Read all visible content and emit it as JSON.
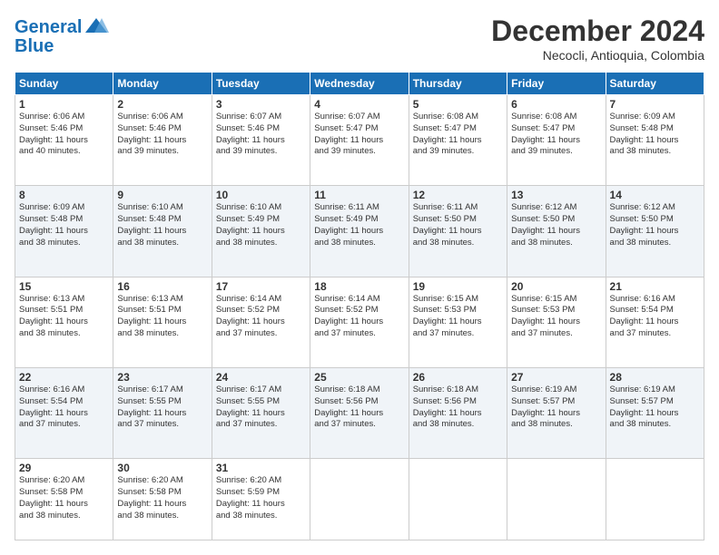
{
  "logo": {
    "line1": "General",
    "line2": "Blue"
  },
  "title": "December 2024",
  "location": "Necocli, Antioquia, Colombia",
  "headers": [
    "Sunday",
    "Monday",
    "Tuesday",
    "Wednesday",
    "Thursday",
    "Friday",
    "Saturday"
  ],
  "weeks": [
    [
      {
        "day": "1",
        "text": "Sunrise: 6:06 AM\nSunset: 5:46 PM\nDaylight: 11 hours\nand 40 minutes."
      },
      {
        "day": "2",
        "text": "Sunrise: 6:06 AM\nSunset: 5:46 PM\nDaylight: 11 hours\nand 39 minutes."
      },
      {
        "day": "3",
        "text": "Sunrise: 6:07 AM\nSunset: 5:46 PM\nDaylight: 11 hours\nand 39 minutes."
      },
      {
        "day": "4",
        "text": "Sunrise: 6:07 AM\nSunset: 5:47 PM\nDaylight: 11 hours\nand 39 minutes."
      },
      {
        "day": "5",
        "text": "Sunrise: 6:08 AM\nSunset: 5:47 PM\nDaylight: 11 hours\nand 39 minutes."
      },
      {
        "day": "6",
        "text": "Sunrise: 6:08 AM\nSunset: 5:47 PM\nDaylight: 11 hours\nand 39 minutes."
      },
      {
        "day": "7",
        "text": "Sunrise: 6:09 AM\nSunset: 5:48 PM\nDaylight: 11 hours\nand 38 minutes."
      }
    ],
    [
      {
        "day": "8",
        "text": "Sunrise: 6:09 AM\nSunset: 5:48 PM\nDaylight: 11 hours\nand 38 minutes."
      },
      {
        "day": "9",
        "text": "Sunrise: 6:10 AM\nSunset: 5:48 PM\nDaylight: 11 hours\nand 38 minutes."
      },
      {
        "day": "10",
        "text": "Sunrise: 6:10 AM\nSunset: 5:49 PM\nDaylight: 11 hours\nand 38 minutes."
      },
      {
        "day": "11",
        "text": "Sunrise: 6:11 AM\nSunset: 5:49 PM\nDaylight: 11 hours\nand 38 minutes."
      },
      {
        "day": "12",
        "text": "Sunrise: 6:11 AM\nSunset: 5:50 PM\nDaylight: 11 hours\nand 38 minutes."
      },
      {
        "day": "13",
        "text": "Sunrise: 6:12 AM\nSunset: 5:50 PM\nDaylight: 11 hours\nand 38 minutes."
      },
      {
        "day": "14",
        "text": "Sunrise: 6:12 AM\nSunset: 5:50 PM\nDaylight: 11 hours\nand 38 minutes."
      }
    ],
    [
      {
        "day": "15",
        "text": "Sunrise: 6:13 AM\nSunset: 5:51 PM\nDaylight: 11 hours\nand 38 minutes."
      },
      {
        "day": "16",
        "text": "Sunrise: 6:13 AM\nSunset: 5:51 PM\nDaylight: 11 hours\nand 38 minutes."
      },
      {
        "day": "17",
        "text": "Sunrise: 6:14 AM\nSunset: 5:52 PM\nDaylight: 11 hours\nand 37 minutes."
      },
      {
        "day": "18",
        "text": "Sunrise: 6:14 AM\nSunset: 5:52 PM\nDaylight: 11 hours\nand 37 minutes."
      },
      {
        "day": "19",
        "text": "Sunrise: 6:15 AM\nSunset: 5:53 PM\nDaylight: 11 hours\nand 37 minutes."
      },
      {
        "day": "20",
        "text": "Sunrise: 6:15 AM\nSunset: 5:53 PM\nDaylight: 11 hours\nand 37 minutes."
      },
      {
        "day": "21",
        "text": "Sunrise: 6:16 AM\nSunset: 5:54 PM\nDaylight: 11 hours\nand 37 minutes."
      }
    ],
    [
      {
        "day": "22",
        "text": "Sunrise: 6:16 AM\nSunset: 5:54 PM\nDaylight: 11 hours\nand 37 minutes."
      },
      {
        "day": "23",
        "text": "Sunrise: 6:17 AM\nSunset: 5:55 PM\nDaylight: 11 hours\nand 37 minutes."
      },
      {
        "day": "24",
        "text": "Sunrise: 6:17 AM\nSunset: 5:55 PM\nDaylight: 11 hours\nand 37 minutes."
      },
      {
        "day": "25",
        "text": "Sunrise: 6:18 AM\nSunset: 5:56 PM\nDaylight: 11 hours\nand 37 minutes."
      },
      {
        "day": "26",
        "text": "Sunrise: 6:18 AM\nSunset: 5:56 PM\nDaylight: 11 hours\nand 38 minutes."
      },
      {
        "day": "27",
        "text": "Sunrise: 6:19 AM\nSunset: 5:57 PM\nDaylight: 11 hours\nand 38 minutes."
      },
      {
        "day": "28",
        "text": "Sunrise: 6:19 AM\nSunset: 5:57 PM\nDaylight: 11 hours\nand 38 minutes."
      }
    ],
    [
      {
        "day": "29",
        "text": "Sunrise: 6:20 AM\nSunset: 5:58 PM\nDaylight: 11 hours\nand 38 minutes."
      },
      {
        "day": "30",
        "text": "Sunrise: 6:20 AM\nSunset: 5:58 PM\nDaylight: 11 hours\nand 38 minutes."
      },
      {
        "day": "31",
        "text": "Sunrise: 6:20 AM\nSunset: 5:59 PM\nDaylight: 11 hours\nand 38 minutes."
      },
      {
        "day": "",
        "text": ""
      },
      {
        "day": "",
        "text": ""
      },
      {
        "day": "",
        "text": ""
      },
      {
        "day": "",
        "text": ""
      }
    ]
  ]
}
